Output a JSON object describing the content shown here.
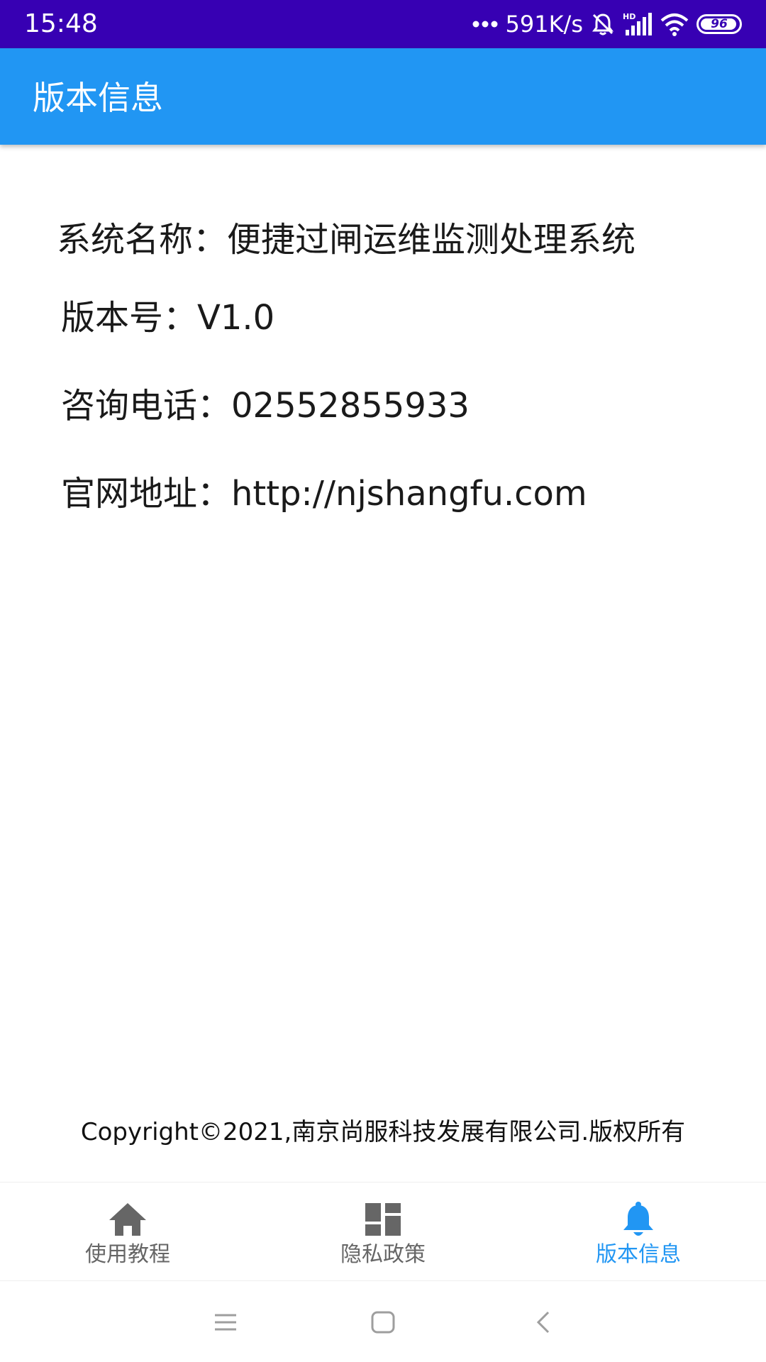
{
  "status_bar": {
    "time": "15:48",
    "net_speed": "591K/s",
    "battery_level": "96",
    "icons": [
      "more-dots-icon",
      "mute-notifications-icon",
      "hd-signal-icon",
      "wifi-icon",
      "battery-icon"
    ]
  },
  "app_bar": {
    "title": "版本信息"
  },
  "info": {
    "system_name": "系统名称：便捷过闸运维监测处理系统",
    "version": "版本号：V1.0",
    "phone": "咨询电话：02552855933",
    "website": "官网地址：http://njshangfu.com"
  },
  "footer": {
    "copyright": "Copyright©2021,南京尚服科技发展有限公司.版权所有"
  },
  "bottom_nav": {
    "items": [
      {
        "label": "使用教程",
        "icon": "home-icon",
        "active": false
      },
      {
        "label": "隐私政策",
        "icon": "dashboard-icon",
        "active": false
      },
      {
        "label": "版本信息",
        "icon": "bell-icon",
        "active": true
      }
    ]
  },
  "colors": {
    "status_bar": "#3700b3",
    "app_bar": "#2196f3",
    "nav_active": "#2196f3",
    "nav_inactive": "#666666"
  }
}
